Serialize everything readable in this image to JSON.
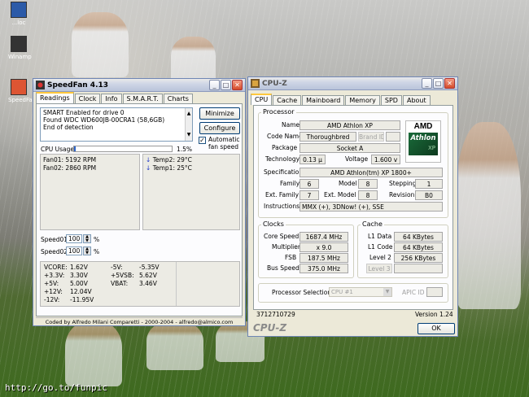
{
  "desktop": {
    "icons": [
      {
        "label": "...loc"
      },
      {
        "label": "Winamp"
      },
      {
        "label": "SpeedFan"
      }
    ],
    "watermark": "http://go.to/funpic"
  },
  "speedfan": {
    "title": "SpeedFan 4.13",
    "tabs": [
      {
        "label": "Readings"
      },
      {
        "label": "Clock"
      },
      {
        "label": "Info"
      },
      {
        "label": "S.M.A.R.T."
      },
      {
        "label": "Charts"
      }
    ],
    "log": [
      "SMART Enabled for drive 0",
      "Found WDC WD600JB-00CRA1 (58,6GB)",
      "End of detection"
    ],
    "minimize_label": "Minimize",
    "configure_label": "Configure",
    "auto_fan_label": "Automatic fan speed",
    "auto_fan_checked": true,
    "cpu_usage_label": "CPU Usage",
    "cpu_usage_value": "1.5%",
    "cpu_usage_fraction": 0.015,
    "fans": [
      "Fan01: 5192 RPM",
      "Fan02: 2860 RPM"
    ],
    "temps": [
      "Temp2: 29°C",
      "Temp1: 25°C"
    ],
    "speeds": [
      {
        "label": "Speed01:",
        "value": "100",
        "unit": "%"
      },
      {
        "label": "Speed02:",
        "value": "100",
        "unit": "%"
      }
    ],
    "volts_left": [
      {
        "name": "VCORE:",
        "value": "1.62V"
      },
      {
        "name": "+3.3V:",
        "value": "3.30V"
      },
      {
        "name": "+5V:",
        "value": "5.00V"
      },
      {
        "name": "+12V:",
        "value": "12.04V"
      },
      {
        "name": "-12V:",
        "value": "-11.95V"
      }
    ],
    "volts_right": [
      {
        "name": "-5V:",
        "value": "-5.35V"
      },
      {
        "name": "+5VSB:",
        "value": "5.62V"
      },
      {
        "name": "VBAT:",
        "value": "3.46V"
      }
    ],
    "status": "Coded by Alfredo Milani Comparetti - 2000-2004 - alfredo@almico.com"
  },
  "cpuz": {
    "title": "CPU-Z",
    "tabs": [
      {
        "label": "CPU"
      },
      {
        "label": "Cache"
      },
      {
        "label": "Mainboard"
      },
      {
        "label": "Memory"
      },
      {
        "label": "SPD"
      },
      {
        "label": "About"
      }
    ],
    "processor_group": "Processor",
    "name_label": "Name",
    "name": "AMD Athlon XP",
    "codename_label": "Code Name",
    "codename": "Thoroughbred",
    "brand_id_label": "Brand ID",
    "package_label": "Package",
    "package": "Socket A",
    "technology_label": "Technology",
    "technology": "0.13 µ",
    "voltage_label": "Voltage",
    "voltage": "1.600 v",
    "spec_label": "Specification",
    "spec": "AMD Athlon(tm) XP 1800+",
    "family_label": "Family",
    "family": "6",
    "model_label": "Model",
    "model": "8",
    "stepping_label": "Stepping",
    "stepping": "1",
    "ext_family_label": "Ext. Family",
    "ext_family": "7",
    "ext_model_label": "Ext. Model",
    "ext_model": "8",
    "revision_label": "Revision",
    "revision": "B0",
    "instructions_label": "Instructions",
    "instructions": "MMX (+), 3DNow! (+), SSE",
    "logo": {
      "brand": "AMD",
      "product": "Athlon",
      "suffix": "XP"
    },
    "clocks_group": "Clocks",
    "core_speed_label": "Core Speed",
    "core_speed": "1687.4 MHz",
    "multiplier_label": "Multiplier",
    "multiplier": "x 9.0",
    "fsb_label": "FSB",
    "fsb": "187.5 MHz",
    "bus_speed_label": "Bus Speed",
    "bus_speed": "375.0 MHz",
    "cache_group": "Cache",
    "l1_data_label": "L1 Data",
    "l1_data": "64 KBytes",
    "l1_code_label": "L1 Code",
    "l1_code": "64 KBytes",
    "level2_label": "Level 2",
    "level2": "256 KBytes",
    "level3_label": "Level 3",
    "proc_sel_label": "Processor Selection",
    "proc_sel": "CPU #1",
    "apic_label": "APIC ID",
    "cpuid_value": "3712710729",
    "version": "Version 1.24",
    "brand_footer": "CPU-Z",
    "ok_label": "OK"
  }
}
